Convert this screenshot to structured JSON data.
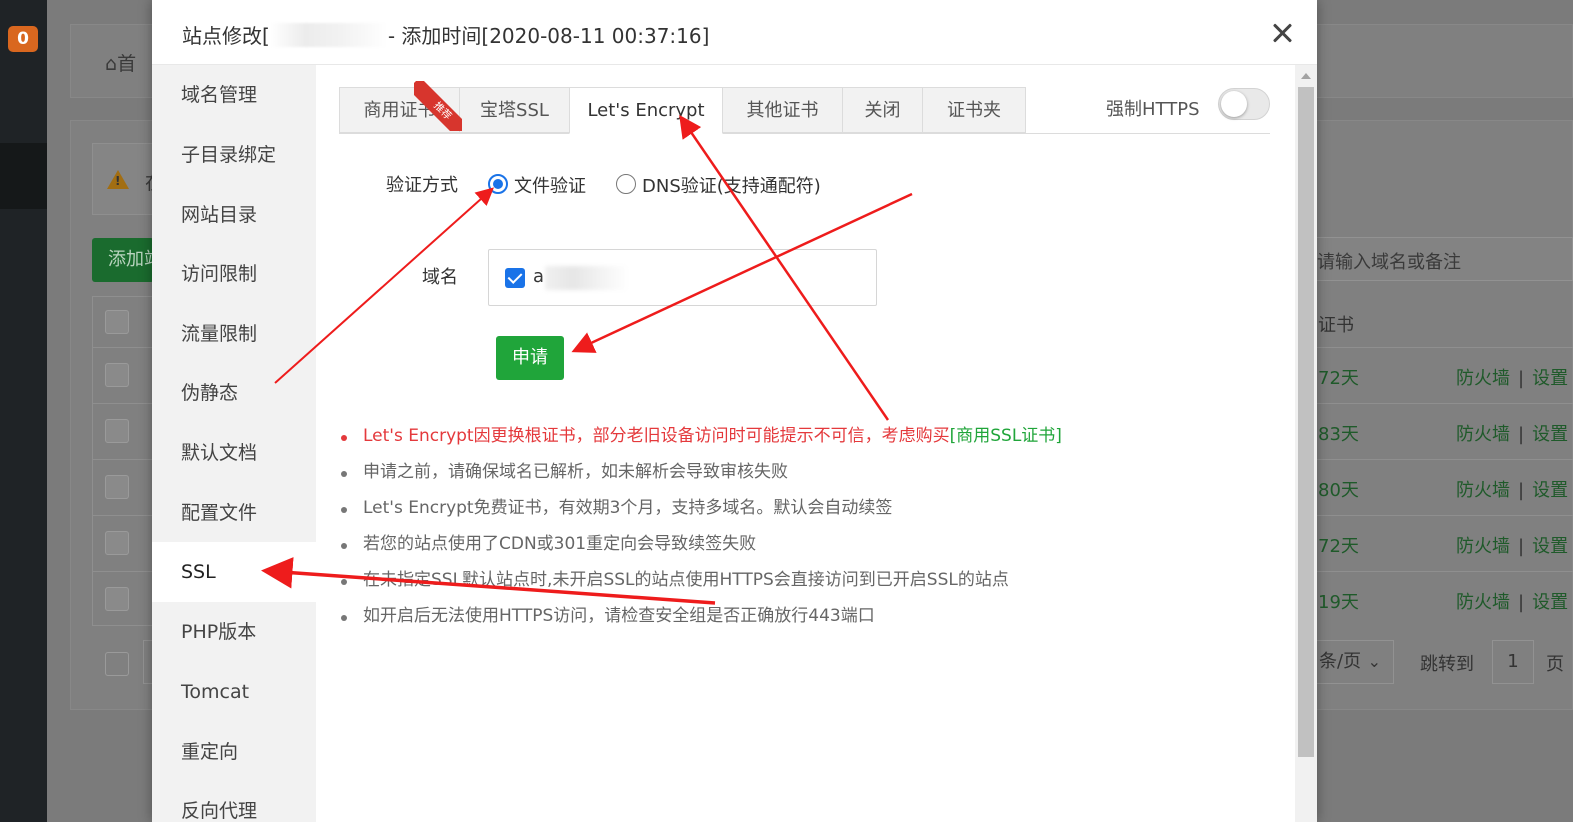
{
  "background": {
    "badge": "0",
    "breadcrumb_home": "首",
    "warning_char": "在",
    "add_button": "添加站点",
    "search_placeholder": "请输入域名或备注",
    "cert_header": "证书",
    "rows": [
      {
        "days": "72天",
        "firewall": "防火墙",
        "sep": "|",
        "settings": "设置"
      },
      {
        "days": "83天",
        "firewall": "防火墙",
        "sep": "|",
        "settings": "设置"
      },
      {
        "days": "80天",
        "firewall": "防火墙",
        "sep": "|",
        "settings": "设置"
      },
      {
        "days": "72天",
        "firewall": "防火墙",
        "sep": "|",
        "settings": "设置"
      },
      {
        "days": "19天",
        "firewall": "防火墙",
        "sep": "|",
        "settings": "设置"
      }
    ],
    "pager": {
      "per_page": "条/页",
      "jump_to": "跳转到",
      "page": "1",
      "page_unit": "页"
    }
  },
  "dialog": {
    "title_prefix": "站点修改[",
    "title_suffix": "- 添加时间[2020-08-11 00:37:16]",
    "nav": [
      "域名管理",
      "子目录绑定",
      "网站目录",
      "访问限制",
      "流量限制",
      "伪静态",
      "默认文档",
      "配置文件",
      "SSL",
      "PHP版本",
      "Tomcat",
      "重定向",
      "反向代理"
    ],
    "tabs": [
      "商用证书",
      "宝塔SSL",
      "Let's Encrypt",
      "其他证书",
      "关闭",
      "证书夹"
    ],
    "tab_ribbon": "推荐",
    "force_https_label": "强制HTTPS",
    "verify_label": "验证方式",
    "verify_options": [
      "文件验证",
      "DNS验证(支持通配符)"
    ],
    "domain_label": "域名",
    "domain_value": "a",
    "apply_button": "申请",
    "notes": {
      "n1_text": "Let's Encrypt因更换根证书，部分老旧设备访问时可能提示不可信，考虑购买",
      "n1_link": "[商用SSL证书]",
      "n2": "申请之前，请确保域名已解析，如未解析会导致审核失败",
      "n3": "Let's Encrypt免费证书，有效期3个月，支持多域名。默认会自动续签",
      "n4": "若您的站点使用了CDN或301重定向会导致续签失败",
      "n5": "在未指定SSL默认站点时,未开启SSL的站点使用HTTPS会直接访问到已开启SSL的站点",
      "n6": "如开启后无法使用HTTPS访问，请检查安全组是否正确放行443端口"
    }
  },
  "colors": {
    "accent_green": "#20a53a",
    "warning_red": "#e4393c",
    "radio_blue": "#1a73e8",
    "annotation_red": "#ee1c1c"
  }
}
